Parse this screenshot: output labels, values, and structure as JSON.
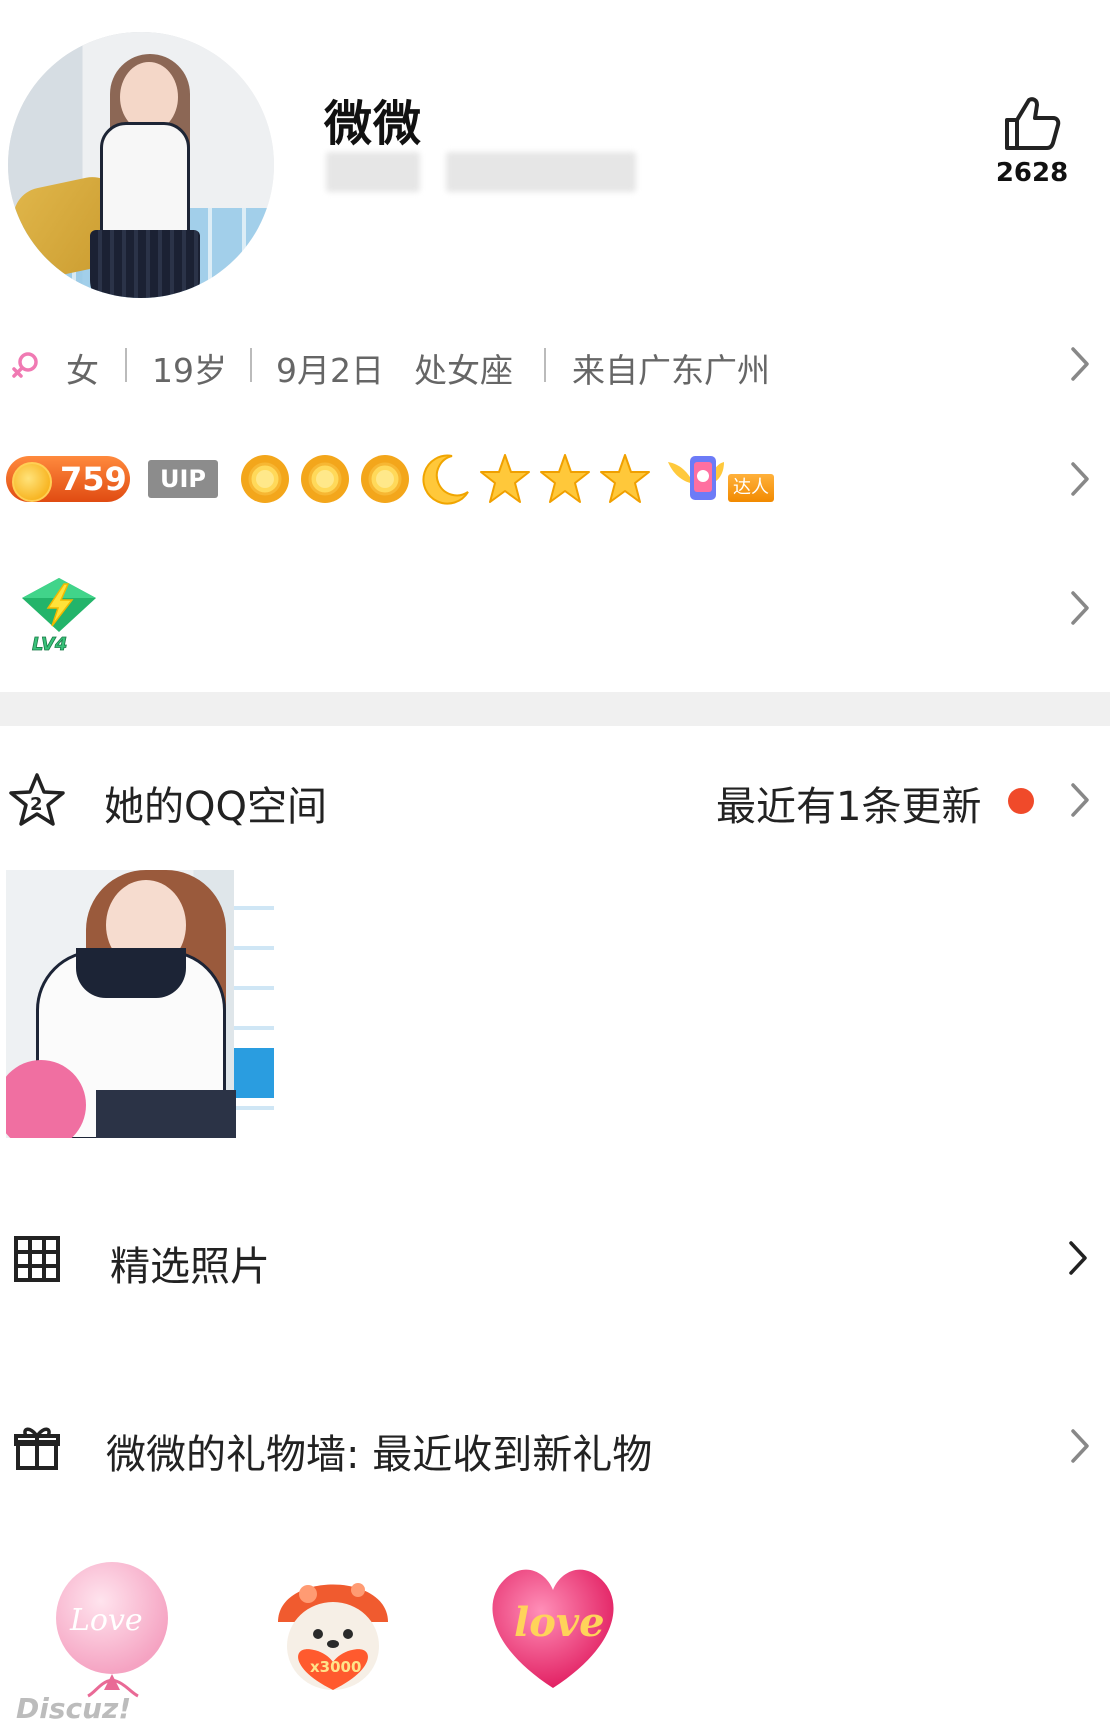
{
  "profile": {
    "name": "微微",
    "likes": "2628"
  },
  "info": {
    "gender": "女",
    "age": "19岁",
    "birthday": "9月2日",
    "zodiac": "处女座",
    "location": "来自广东广州"
  },
  "badges": {
    "coin_value": "759",
    "vip_label": "UIP",
    "level_icons": [
      "sun-icon",
      "sun-icon",
      "sun-icon",
      "moon-icon",
      "star-icon",
      "star-icon",
      "star-icon"
    ],
    "talent_label": "达人"
  },
  "level_row": {
    "gem_icon": "lightning-gem-icon",
    "gem_label": "LV4"
  },
  "qzone": {
    "label": "她的QQ空间",
    "update_text": "最近有1条更新",
    "dot_color": "#f04a2a"
  },
  "photos": {
    "label": "精选照片"
  },
  "gift_wall": {
    "label": "微微的礼物墙: 最近收到新礼物",
    "gifts": [
      {
        "icon": "love-balloon-icon",
        "text": "Love"
      },
      {
        "icon": "mushroom-bear-heart-icon",
        "text": "x3000"
      },
      {
        "icon": "love-heart-icon",
        "text": "love"
      }
    ]
  },
  "watermark": "Discuz!",
  "colors": {
    "accent_red": "#f04a2a",
    "divider": "#f0f0f0",
    "secondary_text": "#666666"
  }
}
